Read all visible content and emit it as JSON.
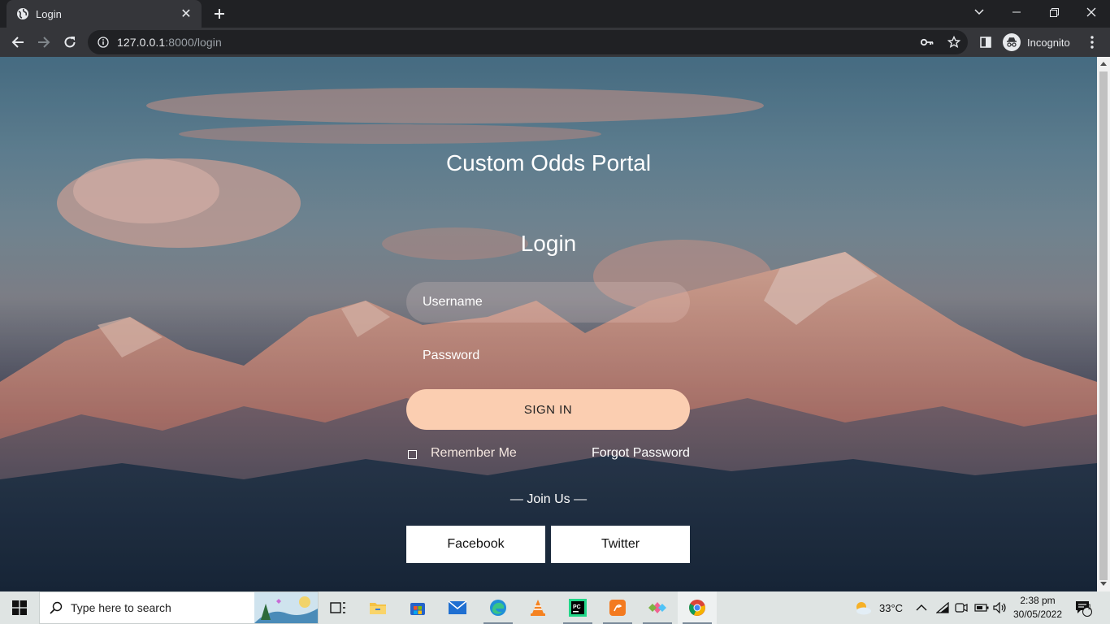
{
  "browser": {
    "tab_title": "Login",
    "url_host": "127.0.0.1",
    "url_path": ":8000/login",
    "profile_label": "Incognito"
  },
  "page": {
    "site_title": "Custom Odds Portal",
    "heading": "Login",
    "username_placeholder": "Username",
    "password_placeholder": "Password",
    "signin_label": "SIGN IN",
    "remember_label": "Remember Me",
    "remember_checked": false,
    "forgot_label": "Forgot Password",
    "join_label": "— Join Us —",
    "facebook_label": "Facebook",
    "twitter_label": "Twitter"
  },
  "taskbar": {
    "search_placeholder": "Type here to search",
    "weather_temp": "33°C",
    "time": "2:38 pm",
    "date": "30/05/2022",
    "notification_count": "1",
    "apps": [
      "task-view",
      "file-explorer",
      "microsoft-store",
      "mail",
      "edge",
      "vlc",
      "pycharm",
      "pdf-app",
      "app-diamond",
      "chrome"
    ]
  },
  "colors": {
    "signin_bg": "#fbceb1",
    "chrome_dark": "#202124",
    "chrome_toolbar": "#35363a",
    "taskbar_bg": "#dfe4e3"
  }
}
